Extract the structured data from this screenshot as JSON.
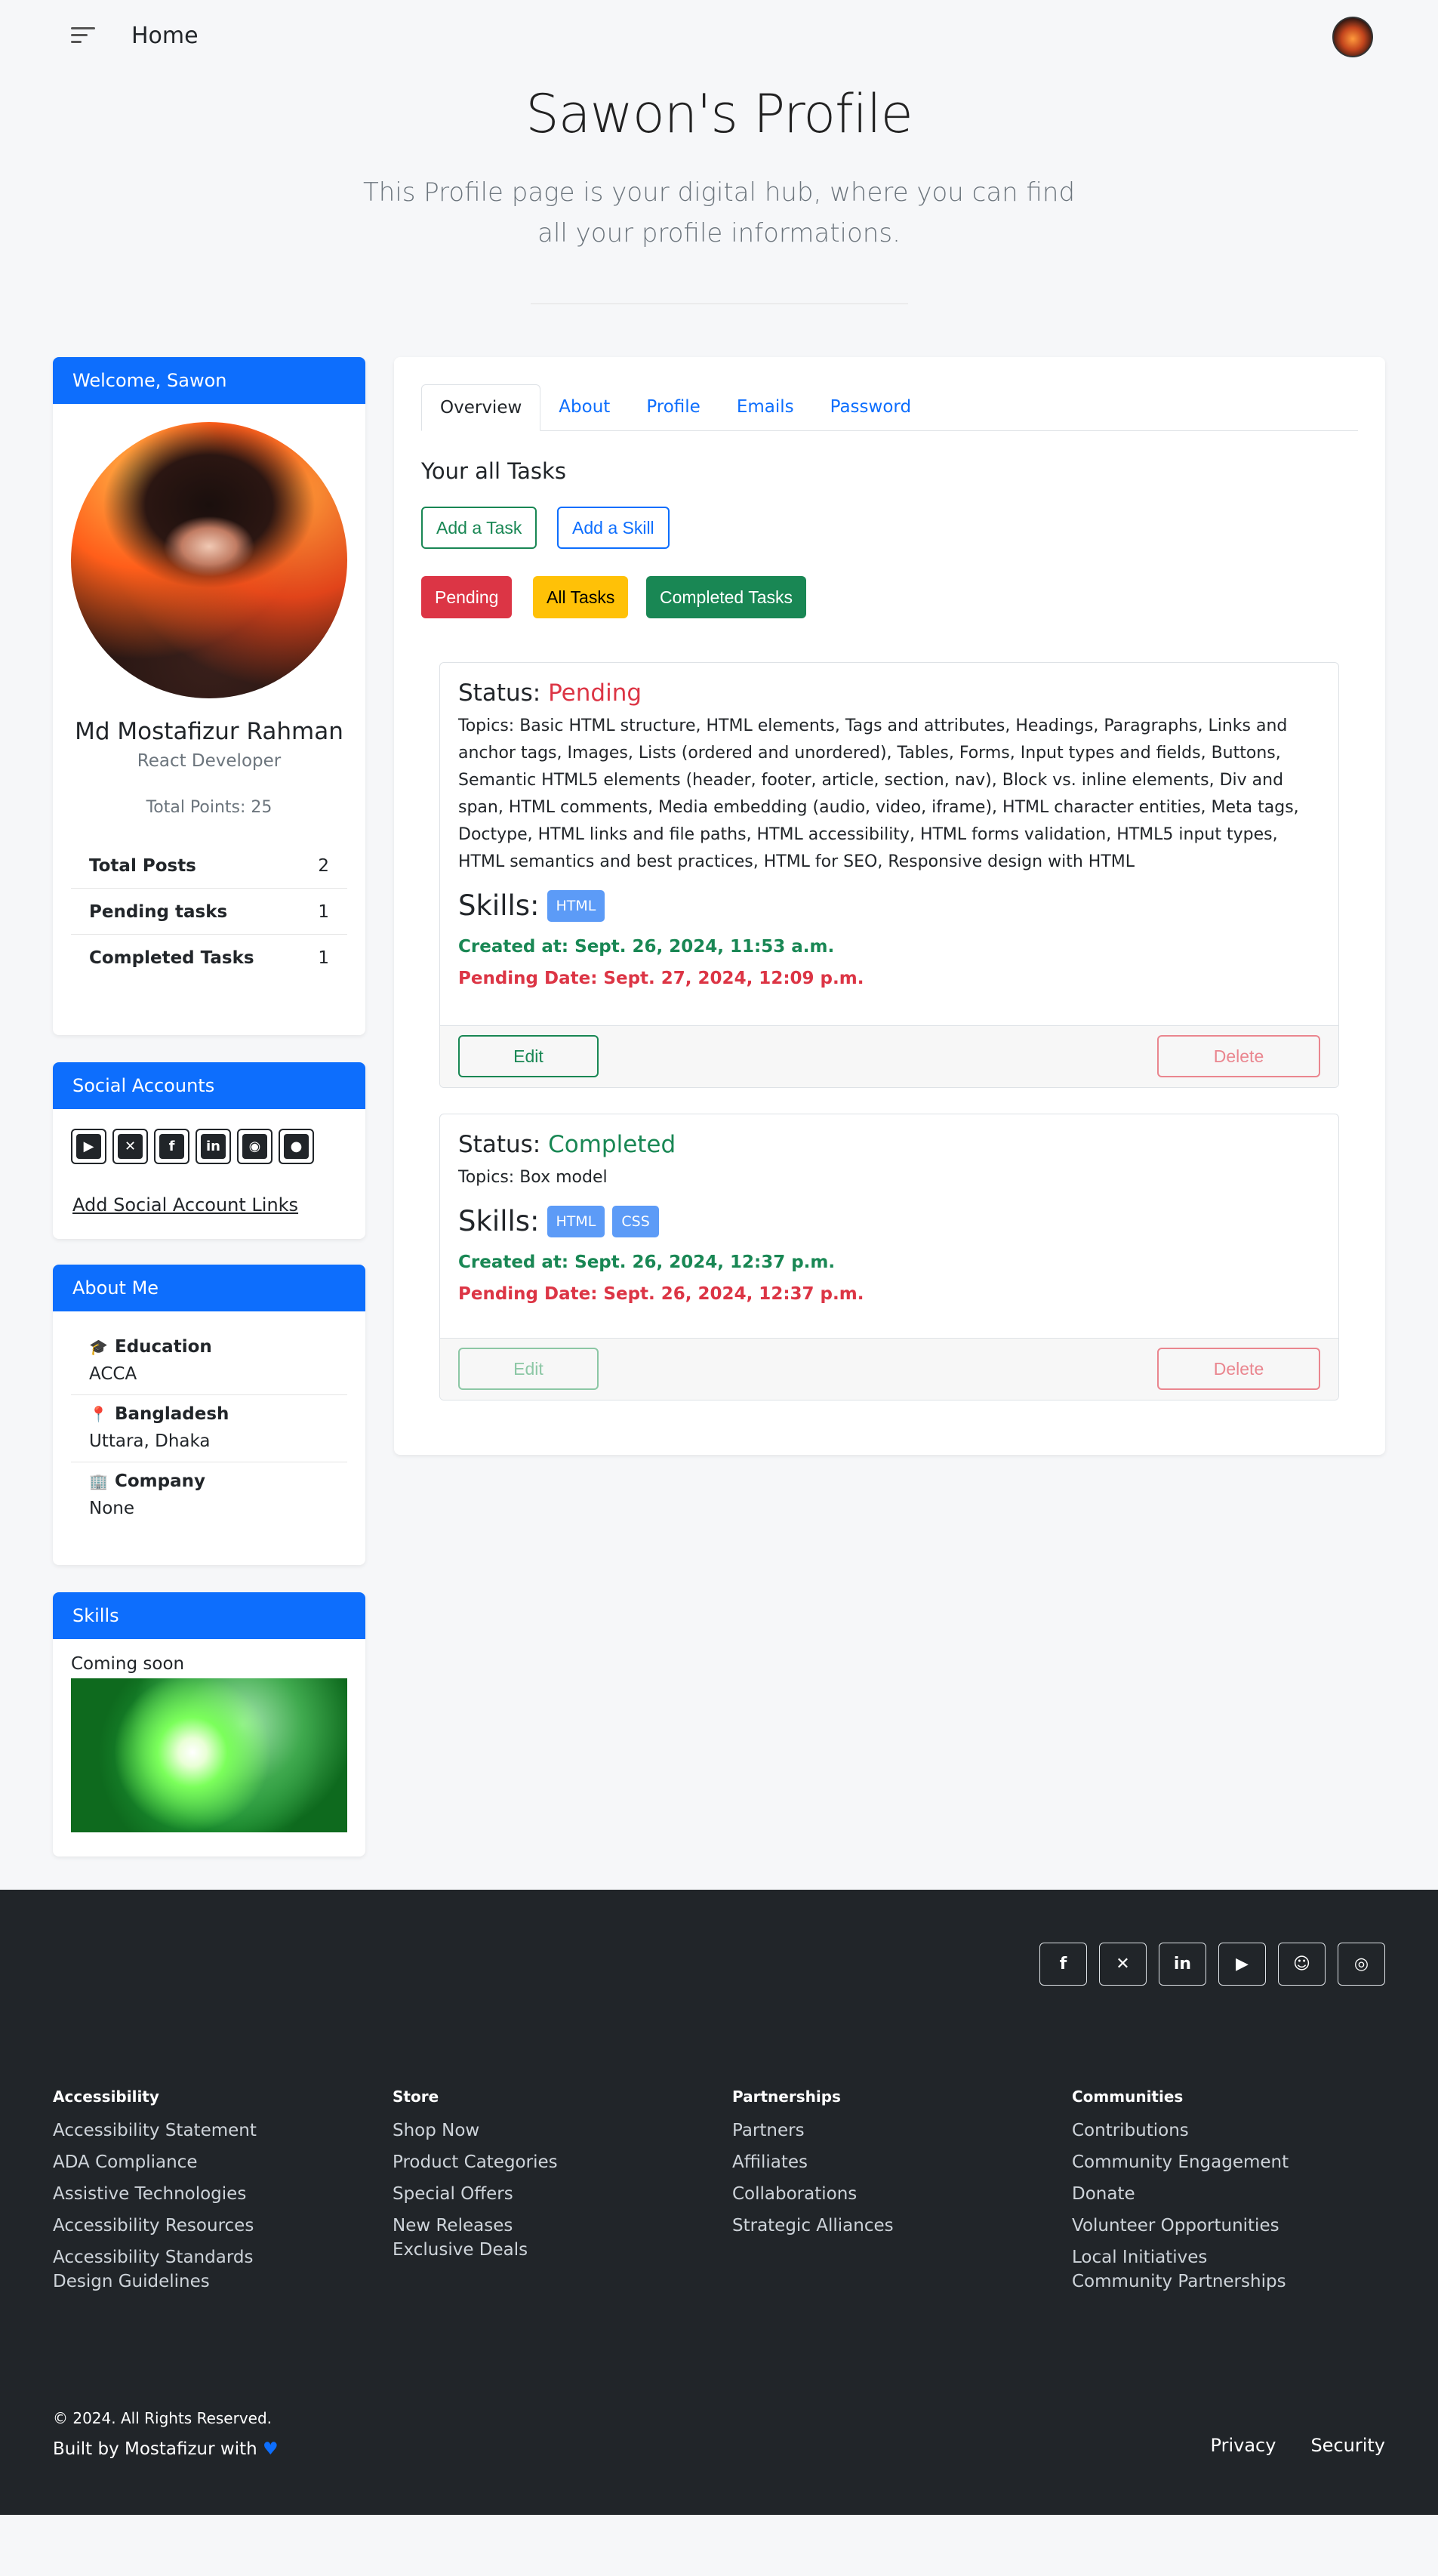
{
  "header": {
    "home_label": "Home"
  },
  "hero": {
    "title": "Sawon's Profile",
    "subtitle": "This Profile page is your digital hub, where you can find all your profile informations."
  },
  "welcome": {
    "header": "Welcome, Sawon",
    "name": "Md Mostafizur Rahman",
    "role": "React Developer",
    "total_points": "Total Points: 25",
    "stats": [
      {
        "label": "Total Posts",
        "value": "2"
      },
      {
        "label": "Pending tasks",
        "value": "1"
      },
      {
        "label": "Completed Tasks",
        "value": "1"
      }
    ]
  },
  "social": {
    "header": "Social Accounts",
    "icons": [
      "youtube-icon",
      "x-icon",
      "facebook-icon",
      "linkedin-icon",
      "portfolio-icon",
      "github-icon"
    ],
    "add_link": "Add Social Account Links"
  },
  "about": {
    "header": "About Me",
    "items": [
      {
        "title": "Education",
        "value": "ACCA",
        "icon": "graduation-cap-icon"
      },
      {
        "title": "Bangladesh",
        "value": "Uttara, Dhaka",
        "icon": "location-pin-icon"
      },
      {
        "title": "Company",
        "value": "None",
        "icon": "building-icon"
      }
    ]
  },
  "skills_card": {
    "header": "Skills",
    "text": "Coming soon"
  },
  "tabs": [
    "Overview",
    "About",
    "Profile",
    "Emails",
    "Password"
  ],
  "tasks": {
    "title": "Your all Tasks",
    "add_task": "Add a Task",
    "add_skill": "Add a Skill",
    "filters": {
      "pending": "Pending",
      "all": "All Tasks",
      "completed": "Completed Tasks"
    },
    "status_label": "Status:",
    "skills_label": "Skills:",
    "edit_label": "Edit",
    "delete_label": "Delete",
    "items": [
      {
        "status": "Pending",
        "topics": "Topics: Basic HTML structure, HTML elements, Tags and attributes, Headings, Paragraphs, Links and anchor tags, Images, Lists (ordered and unordered), Tables, Forms, Input types and fields, Buttons, Semantic HTML5 elements (header, footer, article, section, nav), Block vs. inline elements, Div and span, HTML comments, Media embedding (audio, video, iframe), HTML character entities, Meta tags, Doctype, HTML links and file paths, HTML accessibility, HTML forms validation, HTML5 input types, HTML semantics and best practices, HTML for SEO, Responsive design with HTML",
        "skills": [
          "HTML"
        ],
        "created": "Created at: Sept. 26, 2024, 11:53 a.m.",
        "pending_date": "Pending Date: Sept. 27, 2024, 12:09 p.m."
      },
      {
        "status": "Completed",
        "topics": "Topics: Box model",
        "skills": [
          "HTML",
          "CSS"
        ],
        "created": "Created at: Sept. 26, 2024, 12:37 p.m.",
        "pending_date": "Pending Date: Sept. 26, 2024, 12:37 p.m."
      }
    ]
  },
  "footer": {
    "social_icons": [
      "facebook-icon",
      "x-icon",
      "linkedin-icon",
      "youtube-icon",
      "reddit-icon",
      "dribbble-icon"
    ],
    "columns": [
      {
        "title": "Accessibility",
        "links": [
          "Accessibility Statement",
          "ADA Compliance",
          "Assistive Technologies",
          "Accessibility Resources",
          "Accessibility Standards",
          "Design Guidelines"
        ]
      },
      {
        "title": "Store",
        "links": [
          "Shop Now",
          "Product Categories",
          "Special Offers",
          "New Releases",
          "Exclusive Deals"
        ]
      },
      {
        "title": "Partnerships",
        "links": [
          "Partners",
          "Affiliates",
          "Collaborations",
          "Strategic Alliances"
        ]
      },
      {
        "title": "Communities",
        "links": [
          "Contributions",
          "Community Engagement",
          "Donate",
          "Volunteer Opportunities",
          "Local Initiatives",
          "Community Partnerships"
        ]
      }
    ],
    "copyright": "© 2024. All Rights Reserved.",
    "built_by": "Built by Mostafizur with",
    "links": [
      "Privacy",
      "Security"
    ]
  },
  "colors": {
    "primary": "#0d6efd",
    "danger": "#dc3545",
    "warning": "#ffc107",
    "success": "#198754",
    "footer_bg": "#212529"
  }
}
